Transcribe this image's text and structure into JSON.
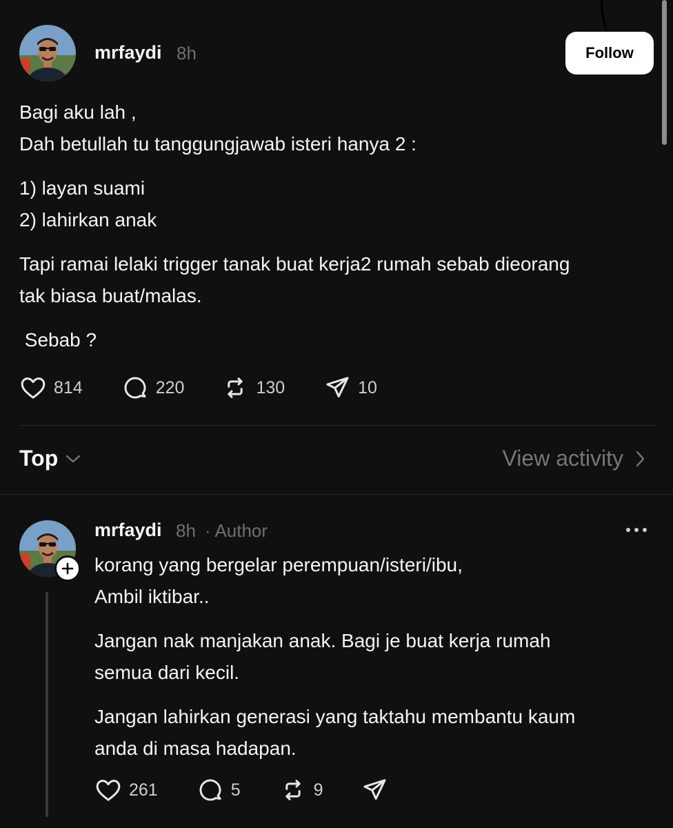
{
  "post": {
    "username": "mrfaydi",
    "time": "8h",
    "follow_label": "Follow",
    "lines": [
      "Bagi aku lah ,",
      "Dah betullah tu tanggungjawab isteri hanya 2 :",
      "1) layan suami",
      "2) lahirkan anak",
      "Tapi ramai lelaki trigger tanak buat kerja2 rumah sebab dieorang",
      "tak biasa buat/malas.",
      " Sebab ?"
    ],
    "likes": "814",
    "replies": "220",
    "reposts": "130",
    "shares": "10"
  },
  "sort": {
    "label": "Top",
    "view_activity": "View activity"
  },
  "reply": {
    "username": "mrfaydi",
    "time": "8h",
    "author_tag": "· Author",
    "lines": [
      "korang yang bergelar perempuan/isteri/ibu,",
      "Ambil iktibar..",
      "Jangan nak manjakan anak. Bagi je buat kerja rumah",
      "semua dari kecil.",
      "Jangan lahirkan generasi yang taktahu membantu kaum",
      "anda di masa hadapan."
    ],
    "likes": "261",
    "replies": "5",
    "reposts": "9"
  },
  "icons": {
    "like": "heart-icon",
    "reply": "comment-icon",
    "repost": "repost-icon",
    "share": "send-icon",
    "more": "more-icon",
    "chevron_down": "chevron-down-icon",
    "chevron_right": "chevron-right-icon",
    "plus": "plus-icon"
  },
  "colors": {
    "background": "#101010",
    "text": "#f3f5f7",
    "muted": "#777777",
    "button_bg": "#ffffff"
  }
}
